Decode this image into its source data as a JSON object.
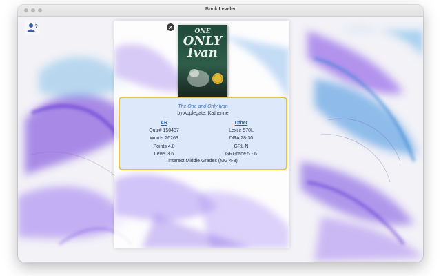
{
  "window": {
    "title": "Book Leveler"
  },
  "book": {
    "cover": {
      "line1": "ONE",
      "line2": "ONLY",
      "line3": "Ivan"
    },
    "title": "The One and Only Ivan",
    "author": "by Applegate, Katherine"
  },
  "ar": {
    "header": "AR",
    "rows": [
      "Quiz# 150437",
      "Words 26263",
      "Points 4.0",
      "Level 3.6"
    ]
  },
  "other": {
    "header": "Other",
    "rows": [
      "Lexile 570L",
      "DRA 28-30",
      "GRL N",
      "GRGrade 5 - 6"
    ]
  },
  "interest": "Interest Middle Grades (MG 4-8)",
  "colors": {
    "accent_blue": "#2d62b0",
    "card_fill": "#dde9fb",
    "card_border": "#e8c23a",
    "purple": "#7a3fe0"
  }
}
